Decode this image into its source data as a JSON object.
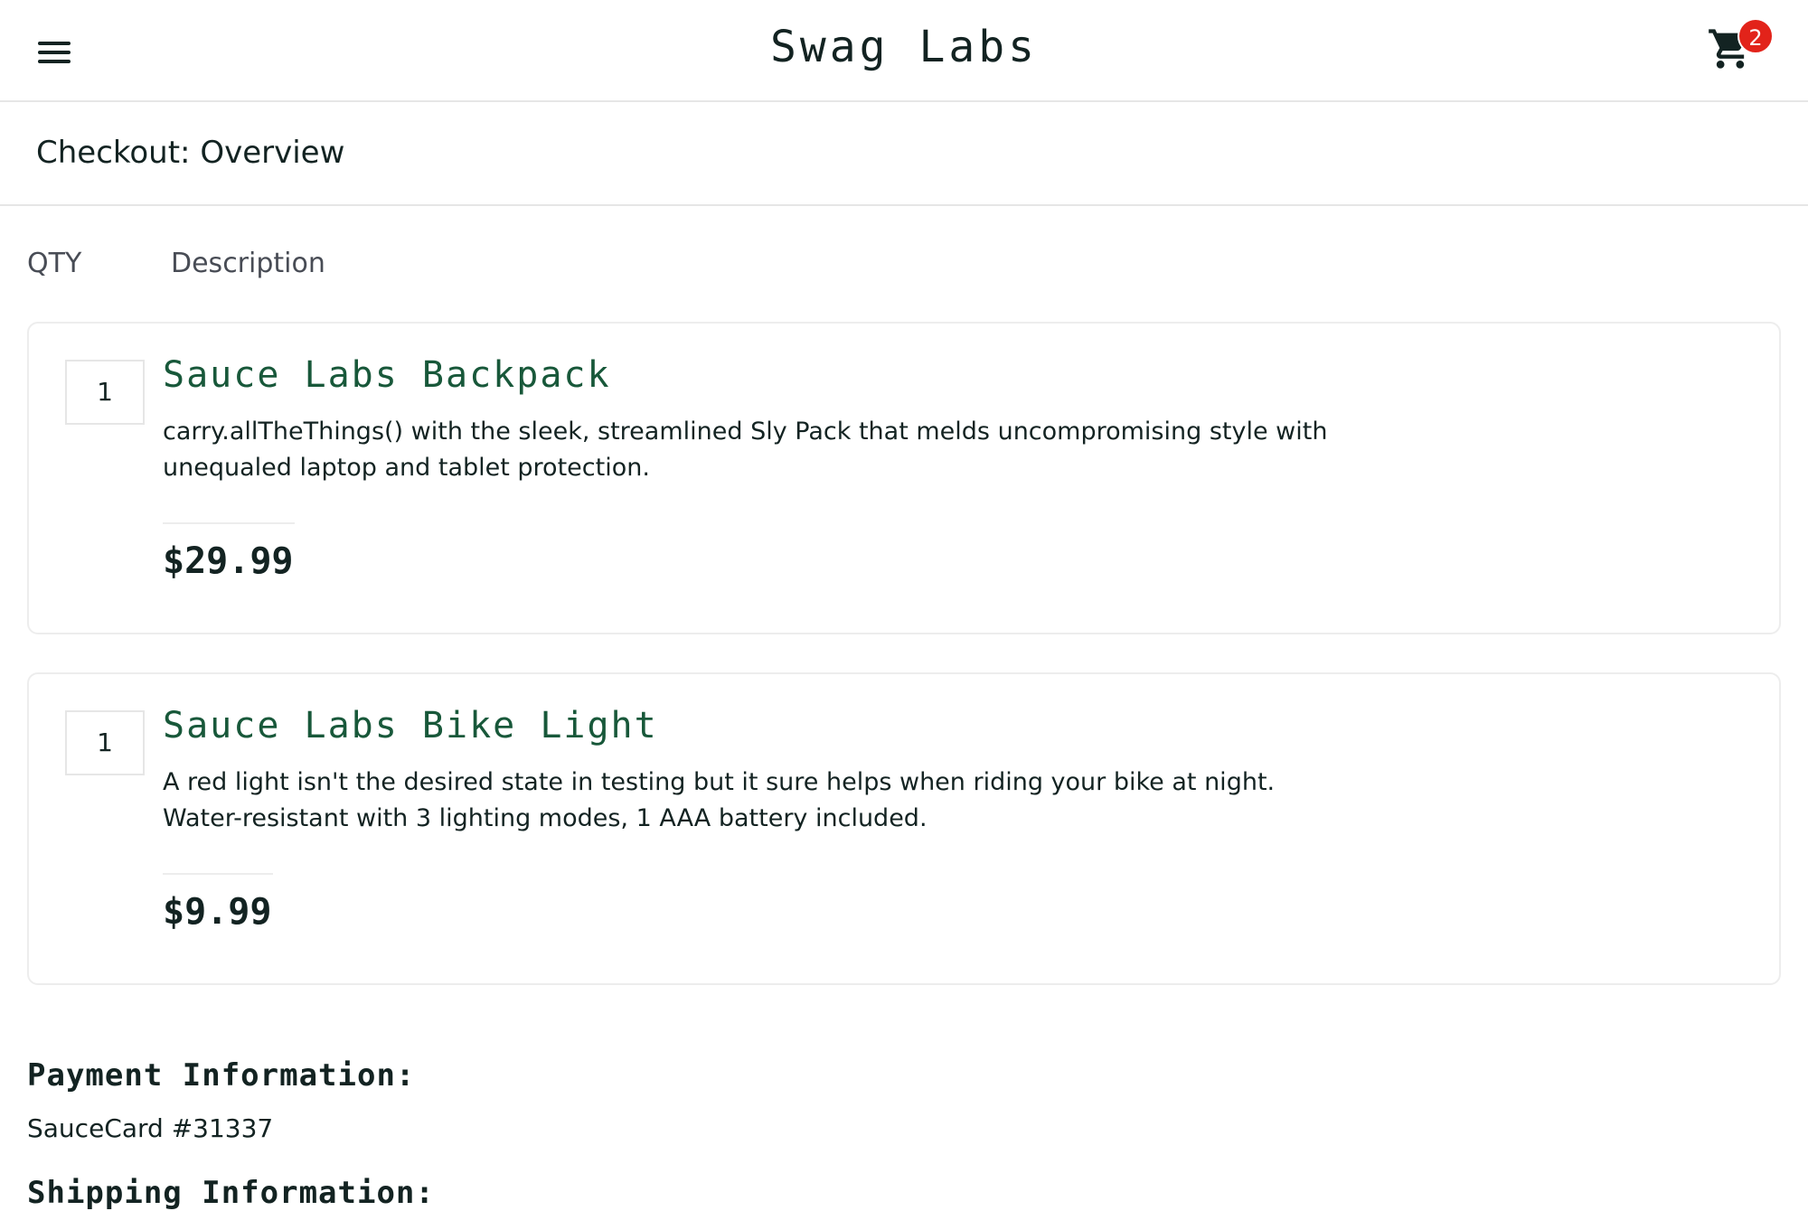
{
  "header": {
    "title": "Swag Labs",
    "menu_icon": "hamburger-menu-icon",
    "cart_icon": "shopping-cart-icon",
    "cart_badge": "2"
  },
  "page": {
    "title": "Checkout: Overview"
  },
  "cart_labels": {
    "qty": "QTY",
    "description": "Description"
  },
  "items": [
    {
      "quantity": "1",
      "name": "Sauce Labs Backpack",
      "description": "carry.allTheThings() with the sleek, streamlined Sly Pack that melds uncompromising style with unequaled laptop and tablet protection.",
      "price": "$29.99"
    },
    {
      "quantity": "1",
      "name": "Sauce Labs Bike Light",
      "description": "A red light isn't the desired state in testing but it sure helps when riding your bike at night. Water-resistant with 3 lighting modes, 1 AAA battery included.",
      "price": "$9.99"
    }
  ],
  "summary": {
    "payment_label": "Payment Information:",
    "payment_value": "SauceCard #31337",
    "shipping_label": "Shipping Information:"
  },
  "colors": {
    "accent_green": "#18583a",
    "badge_red": "#e2231a",
    "text": "#132322"
  }
}
